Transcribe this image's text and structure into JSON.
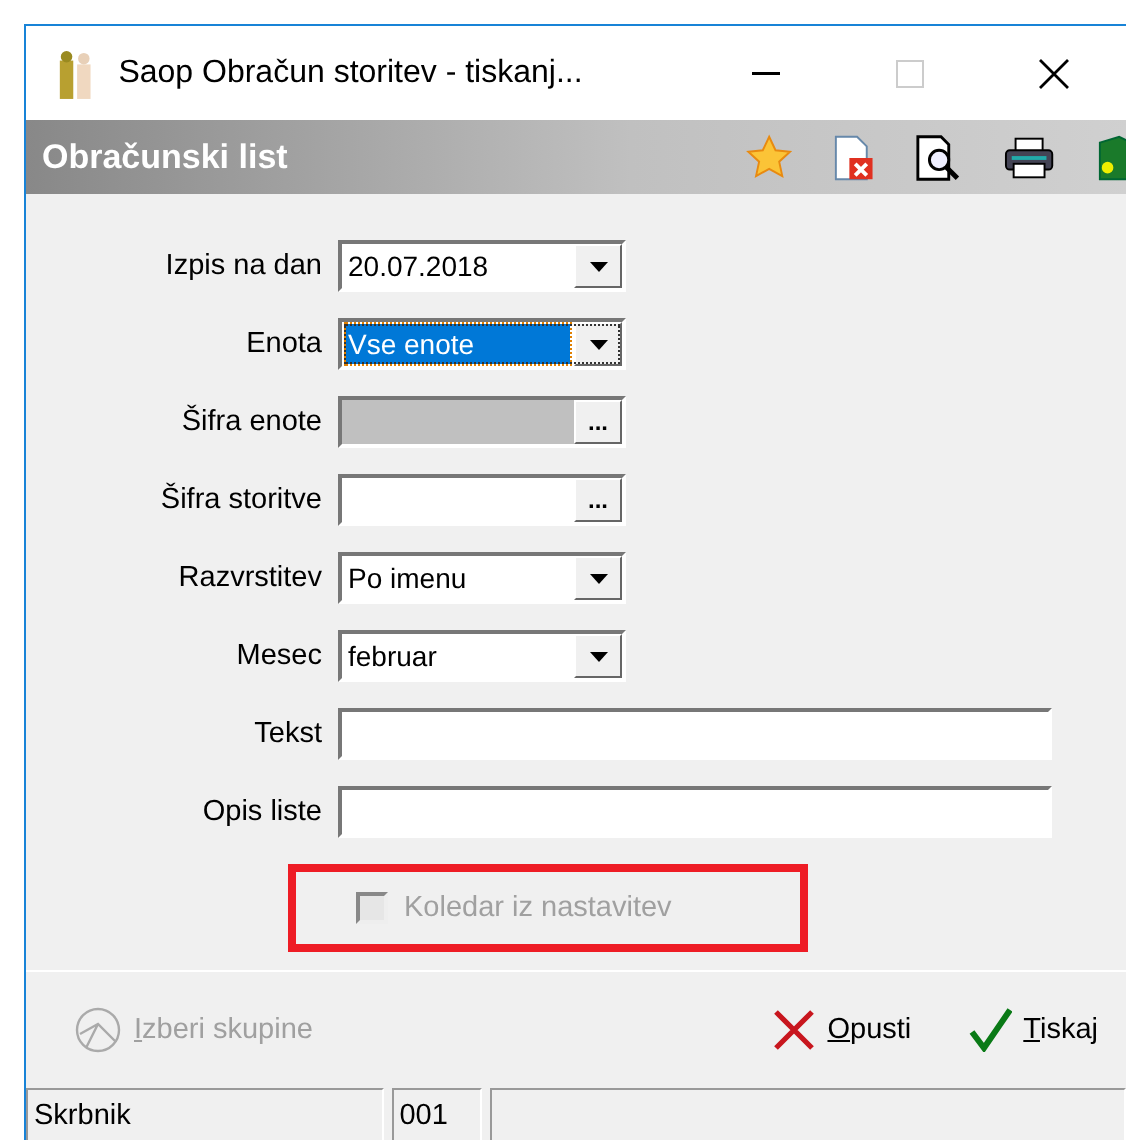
{
  "window": {
    "title": "Saop Obračun storitev - tiskanj..."
  },
  "header": {
    "title": "Obračunski list"
  },
  "fields": [
    {
      "kind": "combo",
      "label": "Izpis na dan",
      "value": "20.07.2018",
      "selected": false,
      "disabled": false
    },
    {
      "kind": "combo",
      "label": "Enota",
      "value": "Vse enote",
      "selected": true,
      "disabled": false
    },
    {
      "kind": "lookup",
      "label": "Šifra enote",
      "button": "...",
      "selected": false,
      "disabled": true
    },
    {
      "kind": "lookup",
      "label": "Šifra storitve",
      "button": "...",
      "selected": false,
      "disabled": false
    },
    {
      "kind": "combo",
      "label": "Razvrstitev",
      "value": "Po imenu",
      "selected": false,
      "disabled": false
    },
    {
      "kind": "combo",
      "label": "Mesec",
      "value": "februar",
      "selected": false,
      "disabled": false
    },
    {
      "kind": "text",
      "label": "Tekst",
      "selected": false,
      "disabled": false
    },
    {
      "kind": "text",
      "label": "Opis liste",
      "selected": false,
      "disabled": false
    }
  ],
  "checkbox": {
    "label": "Koledar iz nastavitev",
    "checked": false,
    "disabled": true,
    "highlighted": true
  },
  "buttons": [
    {
      "kind": "groups",
      "label": "Izberi skupine",
      "disabled": true
    },
    {
      "kind": "cancel",
      "label": "Opusti",
      "disabled": false
    },
    {
      "kind": "print",
      "label": "Tiskaj",
      "disabled": false
    }
  ],
  "status_bar": [
    "Skrbnik",
    "001"
  ]
}
